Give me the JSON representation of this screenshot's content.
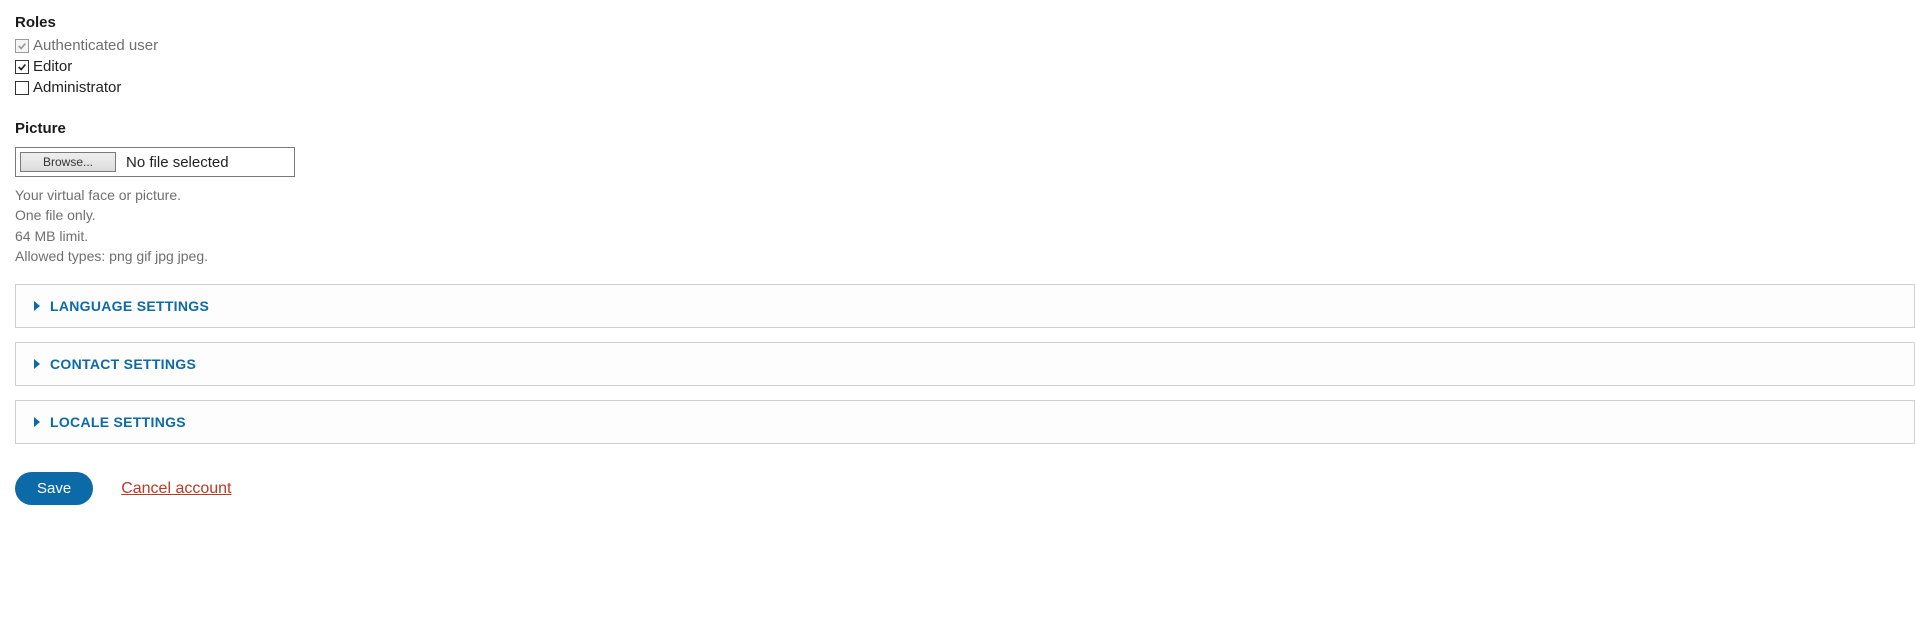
{
  "roles": {
    "heading": "Roles",
    "items": [
      {
        "label": "Authenticated user",
        "checked": true,
        "disabled": true
      },
      {
        "label": "Editor",
        "checked": true,
        "disabled": false
      },
      {
        "label": "Administrator",
        "checked": false,
        "disabled": false
      }
    ]
  },
  "picture": {
    "heading": "Picture",
    "browse_label": "Browse...",
    "file_status": "No file selected",
    "hints": [
      "Your virtual face or picture.",
      "One file only.",
      "64 MB limit.",
      "Allowed types: png gif jpg jpeg."
    ]
  },
  "details": [
    {
      "title": "LANGUAGE SETTINGS"
    },
    {
      "title": "CONTACT SETTINGS"
    },
    {
      "title": "LOCALE SETTINGS"
    }
  ],
  "actions": {
    "save": "Save",
    "cancel": "Cancel account"
  }
}
